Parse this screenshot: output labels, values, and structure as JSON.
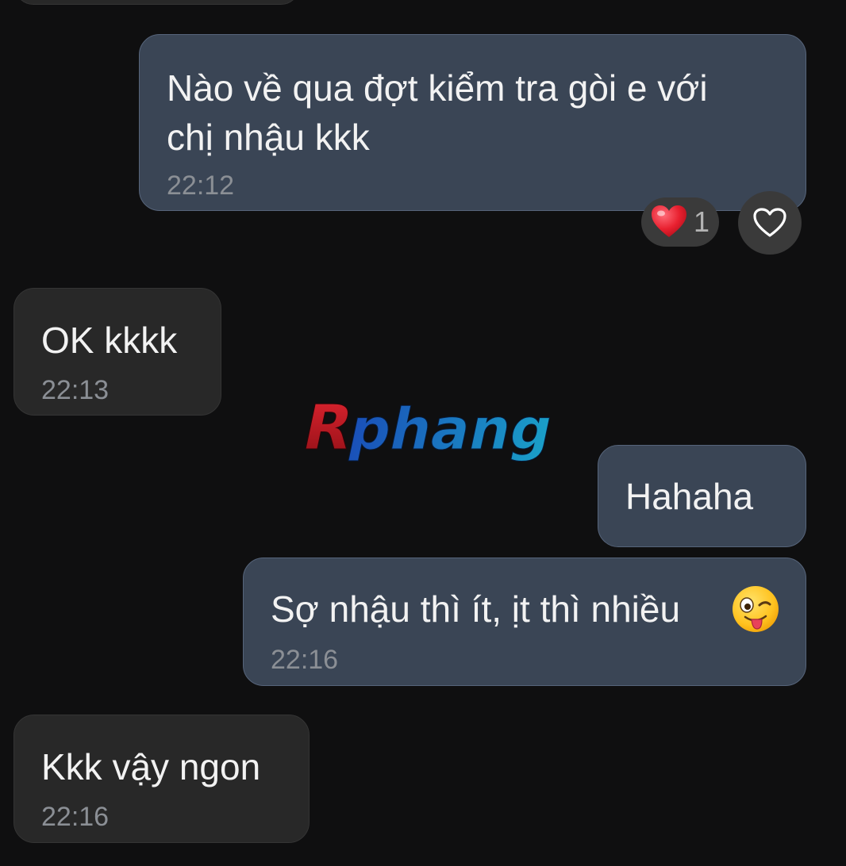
{
  "watermark": {
    "text": "Rphang"
  },
  "messages": [
    {
      "id": "m1",
      "direction": "outgoing",
      "text_lines": [
        "Nào về qua đợt kiểm tra gòi e với",
        "chị nhậu kkk"
      ],
      "time": "22:12",
      "reaction": {
        "emoji": "heart-emoji",
        "count": "1"
      }
    },
    {
      "id": "m2",
      "direction": "incoming",
      "text": "OK kkkk",
      "time": "22:13"
    },
    {
      "id": "m3",
      "direction": "outgoing",
      "text": "Hahaha"
    },
    {
      "id": "m4",
      "direction": "outgoing",
      "text": "Sợ nhậu thì ít, ịt thì nhiều",
      "emoji": "winking-tongue-emoji",
      "time": "22:16"
    },
    {
      "id": "m5",
      "direction": "incoming",
      "text": "Kkk vậy ngon",
      "time": "22:16"
    }
  ],
  "icons": {
    "add_reaction": "heart-outline-icon"
  },
  "colors": {
    "background": "#0f0f10",
    "outgoing_bubble": "#3a4555",
    "incoming_bubble": "#282828",
    "text": "#f2f2f2",
    "timestamp": "#8b8f95",
    "watermark_red": "#c0151e",
    "watermark_blue": "#1a7fc4"
  }
}
